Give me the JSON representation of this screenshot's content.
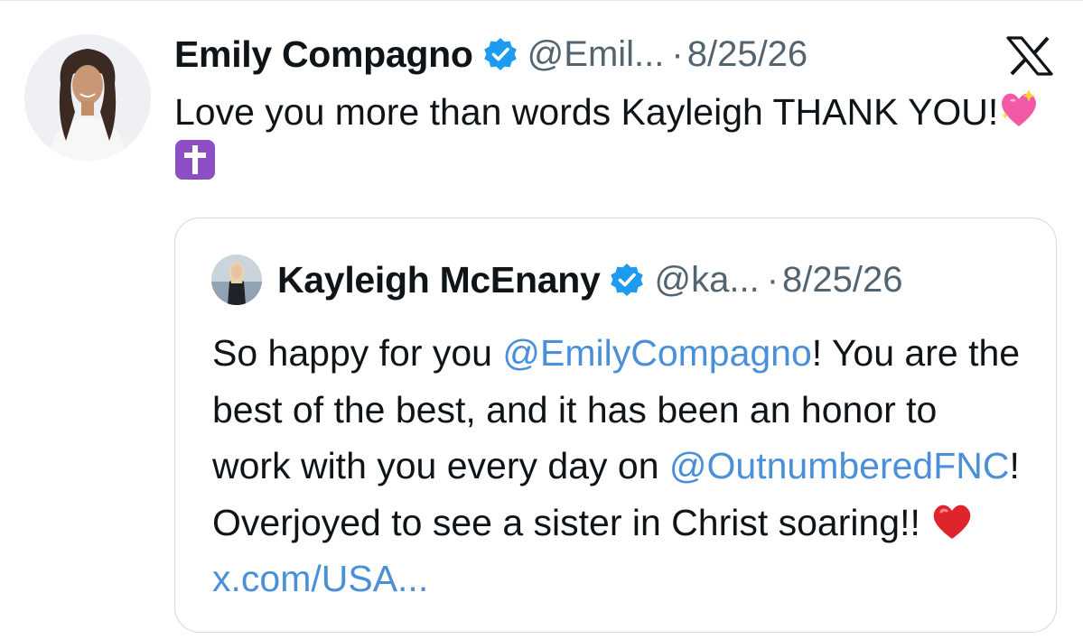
{
  "post": {
    "author_name": "Emily Compagno",
    "handle": "@Emil...",
    "separator": "·",
    "date": "8/25/26",
    "text_line": "Love you more than words Kayleigh THANK YOU!",
    "emojis": [
      "sparkling-heart",
      "latin-cross"
    ],
    "verified": true
  },
  "quoted_post": {
    "author_name": "Kayleigh McEnany",
    "handle": "@ka...",
    "separator": "·",
    "date": "8/25/26",
    "verified": true,
    "text": {
      "part1": "So happy for you ",
      "mention1": "@EmilyCompagno",
      "part2": "! You are the best of the best, and it has been an honor to work with you every day on ",
      "mention2": "@OutnumberedFNC",
      "part3": "! Overjoyed to see a sister in Christ soaring!! ",
      "emoji": "red-heart",
      "link": "x.com/USA..."
    }
  },
  "brand": {
    "logo": "x-logo",
    "verified_color": "#1d9bf0",
    "link_color": "#4a90d9",
    "text_color": "#0f1419",
    "muted_color": "#536471"
  }
}
